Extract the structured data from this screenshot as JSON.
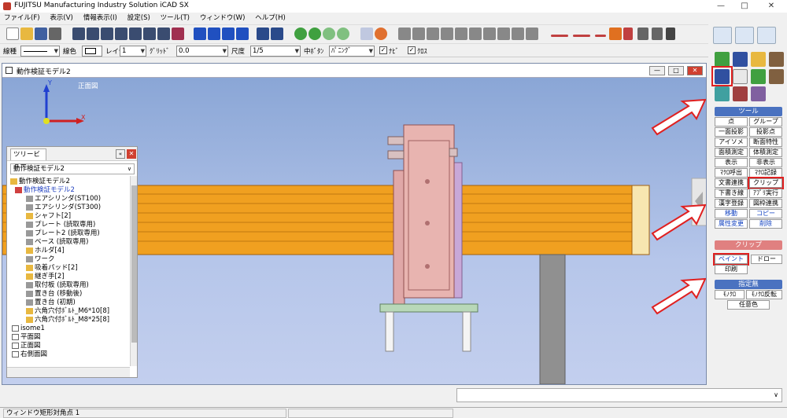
{
  "app": {
    "title": "FUJITSU Manufacturing Industry Solution iCAD SX"
  },
  "window_controls": {
    "minimize": "—",
    "maximize": "□",
    "close": "✕"
  },
  "menu": [
    "ファイル(F)",
    "表示(V)",
    "情報表示(I)",
    "設定(S)",
    "ツール(T)",
    "ウィンドウ(W)",
    "ヘルプ(H)"
  ],
  "toolbar2": {
    "line_type_label": "線種",
    "line_color_label": "線色",
    "layer_label": "レイヤ",
    "layer_value": "1",
    "grid_label": "ｸﾞﾘｯﾄﾞ",
    "grid_value": "0.0",
    "scale_label": "尺度",
    "scale_value": "1/5",
    "middle_button_label": "中ﾎﾞﾀﾝ",
    "middle_button_value": "ﾊﾟﾆﾝｸﾞ",
    "check1_label": "ﾅﾋﾞ",
    "check2_label": "ｸﾛｽ"
  },
  "document": {
    "title": "動作検証モデル2",
    "view_label": "正面図",
    "axis_y": "Y",
    "axis_x": "X"
  },
  "treeview": {
    "tab_label": "ツリービュー",
    "selector_value": "動作検証モデル2",
    "nodes": [
      "動作検証モデル2",
      "動作検証モデル2",
      "エアシリンダ(ST100)",
      "エアシリンダ(ST300)",
      "シャフト[2]",
      "プレート (読取専用)",
      "プレート2 (読取専用)",
      "ベース (読取専用)",
      "ホルダ[4]",
      "ワーク",
      "吸着パッド[2]",
      "継ぎ手[2]",
      "取付板 (読取専用)",
      "置き台 (移動後)",
      "置き台 (初期)",
      "六角穴付ﾎﾞﾙﾄ_M6*10[8]",
      "六角穴付ﾎﾞﾙﾄ_M8*25[8]",
      "isome1",
      "平面図",
      "正面図",
      "右側面図"
    ]
  },
  "right_panel": {
    "tool_section": "ツール",
    "tool_buttons": [
      [
        "点",
        "グループ"
      ],
      [
        "一面投影",
        "投影点"
      ],
      [
        "アイソメ",
        "断面特性"
      ],
      [
        "面積測定",
        "体積測定"
      ],
      [
        "表示",
        "非表示"
      ],
      [
        "ﾏｸﾛ呼出",
        "ﾏｸﾛ記録"
      ],
      [
        "文書連携",
        "クリップ"
      ],
      [
        "下書き線",
        "ｱﾌﾟﾘ実行"
      ],
      [
        "漢字登録",
        "図枠連携"
      ],
      [
        "移動",
        "コピー"
      ],
      [
        "属性変更",
        "削除"
      ]
    ],
    "clip_section": "クリップ",
    "clip_buttons": [
      "ペイント",
      "ドロー",
      "印刷"
    ],
    "spec_section": "指定無",
    "spec_buttons": [
      "ﾓﾉｸﾛ",
      "ﾓﾉｸﾛ反転",
      "任意色"
    ]
  },
  "status": {
    "message": "ウィンドウ矩形対角点 1"
  },
  "colors": {
    "accent": "#4a72c0",
    "highlight": "#e02020",
    "cylinder": "#f0a020"
  }
}
